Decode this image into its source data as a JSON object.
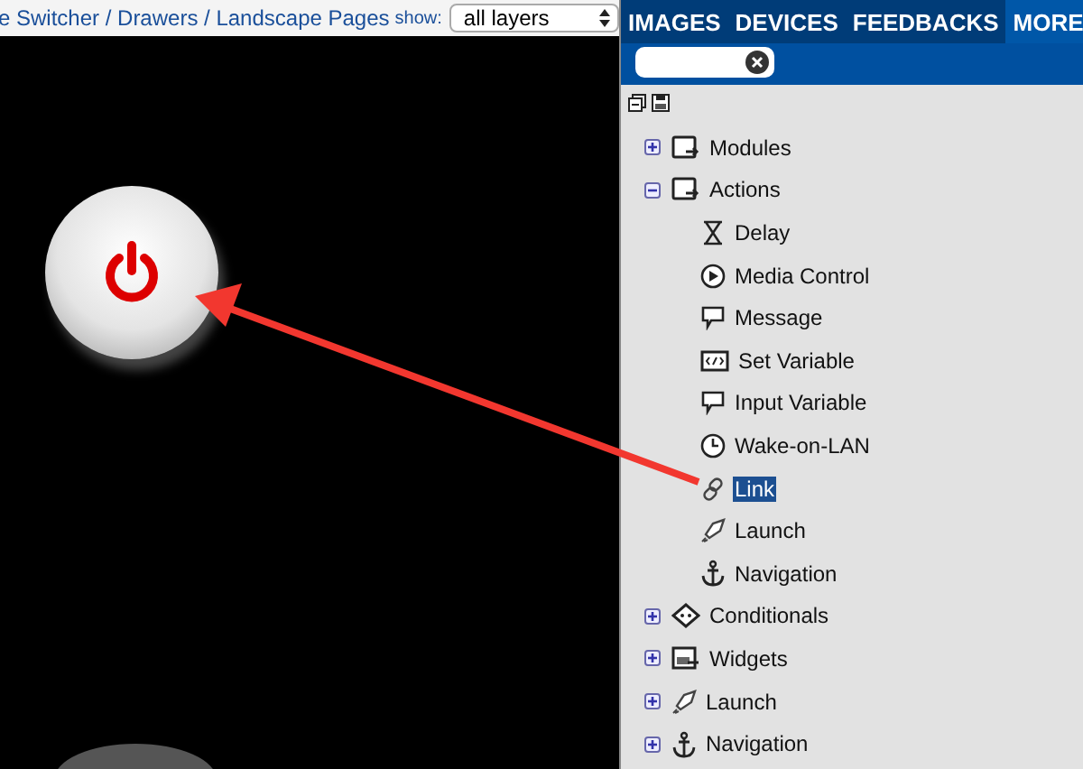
{
  "breadcrumb": "e Switcher / Drawers / Landscape Pages",
  "filter": {
    "label": "show:",
    "value": "all layers"
  },
  "tabs": [
    {
      "label": "IMAGES",
      "selected": false
    },
    {
      "label": "DEVICES",
      "selected": false
    },
    {
      "label": "FEEDBACKS",
      "selected": false
    },
    {
      "label": "MORE",
      "selected": true
    }
  ],
  "tree": [
    {
      "label": "Modules",
      "kind": "modules",
      "expanded": false,
      "selected": false
    },
    {
      "label": "Actions",
      "kind": "actions",
      "expanded": true,
      "selected": false,
      "children": [
        {
          "label": "Delay",
          "kind": "delay",
          "selected": false
        },
        {
          "label": "Media Control",
          "kind": "media",
          "selected": false
        },
        {
          "label": "Message",
          "kind": "message",
          "selected": false
        },
        {
          "label": "Set Variable",
          "kind": "variable",
          "selected": false
        },
        {
          "label": "Input Variable",
          "kind": "message",
          "selected": false
        },
        {
          "label": "Wake-on-LAN",
          "kind": "clock",
          "selected": false
        },
        {
          "label": "Link",
          "kind": "link",
          "selected": true
        },
        {
          "label": "Launch",
          "kind": "launch",
          "selected": false
        },
        {
          "label": "Navigation",
          "kind": "anchor",
          "selected": false
        }
      ]
    },
    {
      "label": "Conditionals",
      "kind": "conditionals",
      "expanded": false,
      "selected": false
    },
    {
      "label": "Widgets",
      "kind": "widgets",
      "expanded": false,
      "selected": false
    },
    {
      "label": "Launch",
      "kind": "launch",
      "expanded": false,
      "selected": false
    },
    {
      "label": "Navigation",
      "kind": "anchor",
      "expanded": false,
      "selected": false
    }
  ]
}
